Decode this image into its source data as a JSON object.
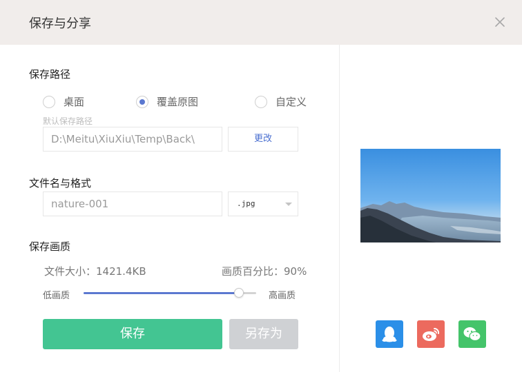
{
  "dialog": {
    "title": "保存与分享"
  },
  "save_path": {
    "title": "保存路径",
    "options": [
      {
        "label": "桌面",
        "checked": false
      },
      {
        "label": "覆盖原图",
        "checked": true
      },
      {
        "label": "自定义",
        "checked": false
      }
    ],
    "hint": "默认保存路径",
    "path_value": "D:\\Meitu\\XiuXiu\\Temp\\Back\\",
    "change_label": "更改"
  },
  "file": {
    "title": "文件名与格式",
    "placeholder": "nature-001",
    "format": ".jpg"
  },
  "quality": {
    "title": "保存画质",
    "size_text": "文件大小：1421.4KB",
    "percent_text": "画质百分比：90%",
    "low_label": "低画质",
    "high_label": "高画质",
    "value": 0.9
  },
  "actions": {
    "save_label": "保存",
    "save_as_label": "另存为"
  },
  "share": {
    "items": [
      {
        "icon": "qq-icon",
        "color": "#2b8fe8"
      },
      {
        "icon": "weibo-icon",
        "color": "#ec6a5e"
      },
      {
        "icon": "wechat-icon",
        "color": "#44c46a"
      }
    ]
  },
  "colors": {
    "accent": "#5b78d0",
    "save": "#43c592",
    "header_bg": "#f1edeb"
  }
}
